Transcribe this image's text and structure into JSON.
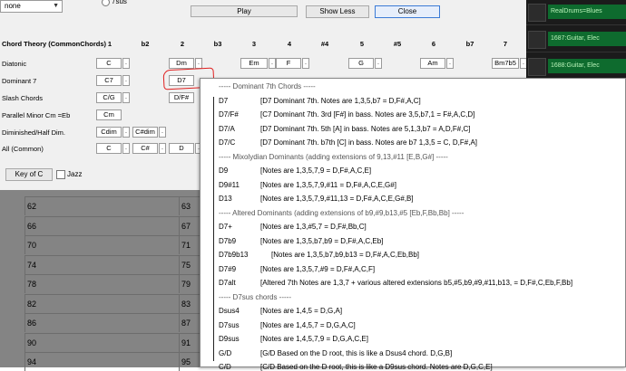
{
  "dialog": {
    "combo_value": "none",
    "radio_label": "7sus",
    "play_label": "Play",
    "show_less_label": "Show Less",
    "close_label": "Close",
    "theory_header": "Chord Theory (CommonChords)",
    "degree_headers": [
      "1",
      "b2",
      "2",
      "b3",
      "3",
      "4",
      "#4",
      "5",
      "#5",
      "6",
      "b7",
      "7"
    ],
    "rows": [
      {
        "label": "Diatonic",
        "chords": [
          "C",
          "Dm",
          "Em",
          "F",
          "G",
          "Am",
          "Bm7b5"
        ]
      },
      {
        "label": "Dominant 7",
        "chords": [
          "C7",
          "D7"
        ]
      },
      {
        "label": "Slash Chords",
        "chords": [
          "C/G",
          "D/F#"
        ]
      },
      {
        "label": "Parallel Minor Cm =Eb",
        "chords": [
          "Cm"
        ]
      },
      {
        "label": "Diminished/Half Dim.",
        "chords": [
          "Cdim",
          "C#dim"
        ]
      },
      {
        "label": "All (Common)",
        "chords": [
          "C",
          "C#",
          "D"
        ]
      }
    ],
    "dot_label": ".",
    "key_button_label": "Key of C",
    "jazz_label": "Jazz"
  },
  "grid": {
    "left_numbers": [
      "62",
      "66",
      "70",
      "74",
      "78",
      "82",
      "86",
      "90",
      "94"
    ],
    "right_numbers": [
      "63",
      "67",
      "71",
      "75",
      "79",
      "83",
      "87",
      "91",
      "95"
    ]
  },
  "tracks": [
    {
      "label": "RealDrums=Blues"
    },
    {
      "label": "1687:Guitar, Elec"
    },
    {
      "label": "1688:Guitar, Elec"
    }
  ],
  "popup": {
    "sections": [
      {
        "header": "----- Dominant 7th Chords -----",
        "items": [
          {
            "name": "D7",
            "desc": "[D7 Dominant 7th. Notes are 1,3,5,b7 = D,F#,A,C]"
          },
          {
            "name": "D7/F#",
            "desc": "[C7 Dominant 7th. 3rd  [F#] in bass. Notes are 3,5,b7,1 = F#,A,C,D]"
          },
          {
            "name": "D7/A",
            "desc": "[D7 Dominant 7th. 5th [A] in bass. Notes are 5,1,3,b7 = A,D,F#,C]"
          },
          {
            "name": "D7/C",
            "desc": "[D7 Dominant 7th. b7th [C] in bass. Notes are b7 1,3,5 = C, D,F#,A]"
          }
        ]
      },
      {
        "header": "----- Mixolydian Dominants  (adding extensions of 9,13,#11 [E,B,G#] -----",
        "items": [
          {
            "name": "D9",
            "desc": "[Notes are 1,3,5,7,9 = D,F#,A,C,E]"
          },
          {
            "name": "D9#11",
            "desc": "[Notes are 1,3,5,7,9,#11 = D,F#,A,C,E,G#]"
          },
          {
            "name": "D13",
            "desc": "[Notes are 1,3,5,7,9,#11,13 = D,F#,A,C,E,G#,B]"
          }
        ]
      },
      {
        "header": "----- Altered Dominants (adding extensions of b9,#9,b13,#5 [Eb,F,Bb,Bb] -----",
        "items": [
          {
            "name": "D7+",
            "desc": "[Notes are 1,3,#5,7 = D,F#,Bb,C]"
          },
          {
            "name": "D7b9",
            "desc": "[Notes are 1,3,5,b7,b9 = D,F#,A,C,Eb]"
          },
          {
            "name": "D7b9b13",
            "desc": "[Notes are 1,3,5,b7,b9,b13 = D,F#,A,C,Eb,Bb]"
          },
          {
            "name": "D7#9",
            "desc": "[Notes are 1,3,5,7,#9 = D,F#,A,C,F]"
          },
          {
            "name": "D7alt",
            "desc": "[Altered 7th Notes are 1,3,7 + various altered extensions b5,#5,b9,#9,#11,b13,  = D,F#,C,Eb,F,Bb]"
          }
        ]
      },
      {
        "header": "----- D7sus chords -----",
        "items": [
          {
            "name": "Dsus4",
            "desc": "[Notes are 1,4,5 = D,G,A]"
          },
          {
            "name": "D7sus",
            "desc": "[Notes are 1,4,5,7 = D,G,A,C]"
          },
          {
            "name": "D9sus",
            "desc": "[Notes are 1,4,5,7,9 = D,G,A,C,E]"
          },
          {
            "name": "G/D",
            "desc": "[G/D Based on the D root, this is like a Dsus4 chord. D,G,B]"
          },
          {
            "name": "C/D",
            "desc": "[C/D Based on the D root, this is like a D9sus chord. Notes are D,G,C,E]"
          }
        ]
      }
    ]
  },
  "colors": {
    "annotation": "#e02020",
    "track_green": "#0e6b2e",
    "grid_gray": "#848484"
  }
}
